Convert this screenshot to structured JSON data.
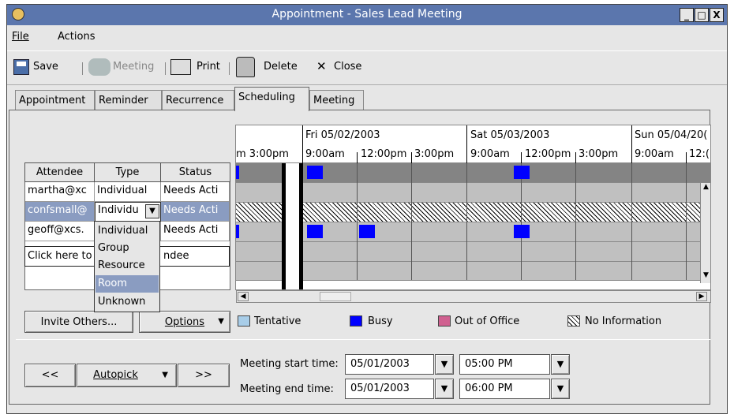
{
  "window": {
    "title": "Appointment - Sales Lead Meeting",
    "min": "_",
    "max": "□",
    "close": "X"
  },
  "menu": {
    "file": "File",
    "actions": "Actions"
  },
  "toolbar": {
    "save": "Save",
    "meeting": "Meeting",
    "print": "Print",
    "delete": "Delete",
    "close": "Close"
  },
  "tabs": [
    "Appointment",
    "Reminder",
    "Recurrence",
    "Scheduling",
    "Meeting"
  ],
  "attendees": {
    "headers": [
      "Attendee",
      "Type",
      "Status"
    ],
    "rows": [
      {
        "attendee": "martha@xc",
        "type": "Individual",
        "status": "Needs Acti"
      },
      {
        "attendee": "confsmall@",
        "type": "Individu",
        "status": "Needs Acti"
      },
      {
        "attendee": "geoff@xcs.",
        "type": "",
        "status": "Needs Acti"
      }
    ],
    "add_prompt_left": "Click here to",
    "add_prompt_right": "ndee"
  },
  "type_dropdown": {
    "options": [
      "Individual",
      "Group",
      "Resource",
      "Room",
      "Unknown"
    ],
    "highlighted": "Room"
  },
  "calendar": {
    "days": [
      "Fri 05/02/2003",
      "Sat 05/03/2003",
      "Sun 05/04/20("
    ],
    "times": [
      "m 3:00pm",
      "9:00am",
      "12:00pm",
      "3:00pm",
      "9:00am",
      "12:00pm",
      "3:00pm",
      "9:00am",
      "12:("
    ]
  },
  "buttons": {
    "invite": "Invite Others...",
    "options": "Options",
    "prev": "<<",
    "autopick": "Autopick",
    "next": ">>"
  },
  "legend": {
    "tentative": "Tentative",
    "busy": "Busy",
    "out_of_office": "Out of Office",
    "no_information": "No Information"
  },
  "legend_colors": {
    "tentative": "#a8cde8",
    "busy": "#0000ff",
    "out_of_office": "#d06090"
  },
  "meeting": {
    "start_label": "Meeting start time:",
    "end_label": "Meeting end time:",
    "start_date": "05/01/2003",
    "start_time": "05:00 PM",
    "end_date": "05/01/2003",
    "end_time": "06:00 PM"
  }
}
